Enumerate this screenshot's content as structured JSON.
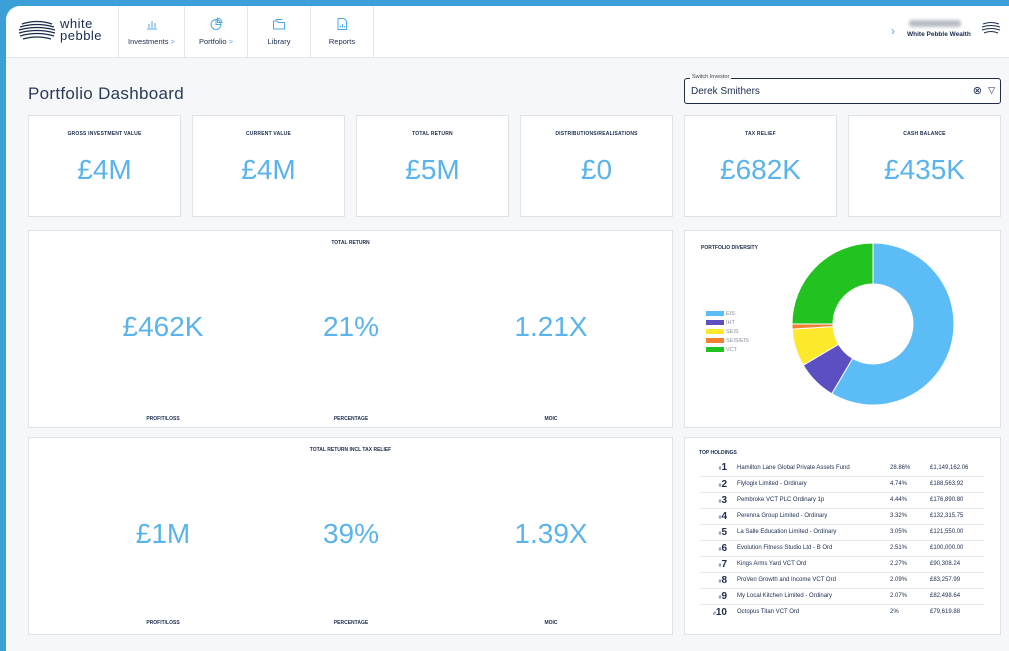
{
  "header": {
    "logo_line1": "white",
    "logo_line2": "pebble",
    "nav": [
      {
        "label": "Investments",
        "chevron": ">",
        "icon": "bar-chart-icon"
      },
      {
        "label": "Portfolio",
        "chevron": ">",
        "icon": "pie-chart-icon"
      },
      {
        "label": "Library",
        "chevron": "",
        "icon": "folder-icon"
      },
      {
        "label": "Reports",
        "chevron": "",
        "icon": "report-icon"
      }
    ],
    "user_org": "White Pebble Wealth"
  },
  "page": {
    "title": "Portfolio Dashboard"
  },
  "switch_investor": {
    "legend": "Switch Investor",
    "value": "Derek Smithers",
    "clear_icon": "⊗",
    "caret_icon": "▽"
  },
  "kpis": [
    {
      "title": "GROSS INVESTMENT VALUE",
      "value": "£4M"
    },
    {
      "title": "CURRENT VALUE",
      "value": "£4M"
    },
    {
      "title": "TOTAL RETURN",
      "value": "£5M"
    },
    {
      "title": "DISTRIBUTIONS/REALISATIONS",
      "value": "£0"
    },
    {
      "title": "TAX RELIEF",
      "value": "£682K"
    },
    {
      "title": "CASH BALANCE",
      "value": "£435K"
    }
  ],
  "total_return": {
    "title": "TOTAL RETURN",
    "metrics": [
      {
        "value": "£462K",
        "label": "PROFIT/LOSS"
      },
      {
        "value": "21%",
        "label": "PERCENTAGE"
      },
      {
        "value": "1.21X",
        "label": "MOIC"
      }
    ]
  },
  "total_return_tax": {
    "title": "TOTAL RETURN INCL TAX RELIEF",
    "metrics": [
      {
        "value": "£1M",
        "label": "PROFIT/LOSS"
      },
      {
        "value": "39%",
        "label": "PERCENTAGE"
      },
      {
        "value": "1.39X",
        "label": "MOIC"
      }
    ]
  },
  "diversity": {
    "title": "PORTFOLIO DIVERSITY",
    "segments": [
      {
        "name": "EIS",
        "value": 58.5,
        "color": "#5bbcf6"
      },
      {
        "name": "IHT",
        "value": 8.0,
        "color": "#5b4fc2"
      },
      {
        "name": "SEIS",
        "value": 7.5,
        "color": "#fde92b"
      },
      {
        "name": "SEIS/EIS",
        "value": 1.0,
        "color": "#f1812e"
      },
      {
        "name": "VCT",
        "value": 25.0,
        "color": "#22c321"
      }
    ]
  },
  "holdings": {
    "title": "TOP HOLDINGS",
    "rows": [
      {
        "rank": "1",
        "name": "Hamilton Lane Global Private Assets Fund",
        "pct": "28.86%",
        "amount": "£1,149,162.06"
      },
      {
        "rank": "2",
        "name": "Flylogix Limited - Ordinary",
        "pct": "4.74%",
        "amount": "£188,563.92"
      },
      {
        "rank": "3",
        "name": "Pembroke VCT PLC Ordinary 1p",
        "pct": "4.44%",
        "amount": "£176,890.80"
      },
      {
        "rank": "4",
        "name": "Perenna Group Limited - Ordinary",
        "pct": "3.32%",
        "amount": "£132,315.75"
      },
      {
        "rank": "5",
        "name": "La Salle Education Limited - Ordinary",
        "pct": "3.05%",
        "amount": "£121,550.00"
      },
      {
        "rank": "6",
        "name": "Evolution Fitness Studio Ltd - B Ord",
        "pct": "2.51%",
        "amount": "£100,000.00"
      },
      {
        "rank": "7",
        "name": "Kings Arms Yard VCT Ord",
        "pct": "2.27%",
        "amount": "£90,308.24"
      },
      {
        "rank": "8",
        "name": "ProVen Growth and Income VCT Ord",
        "pct": "2.09%",
        "amount": "£83,257.99"
      },
      {
        "rank": "9",
        "name": "My Local Kitchen Limited - Ordinary",
        "pct": "2.07%",
        "amount": "£82,498.64"
      },
      {
        "rank": "10",
        "name": "Octopus Titan VCT Ord",
        "pct": "2%",
        "amount": "£79,619.88"
      }
    ]
  }
}
